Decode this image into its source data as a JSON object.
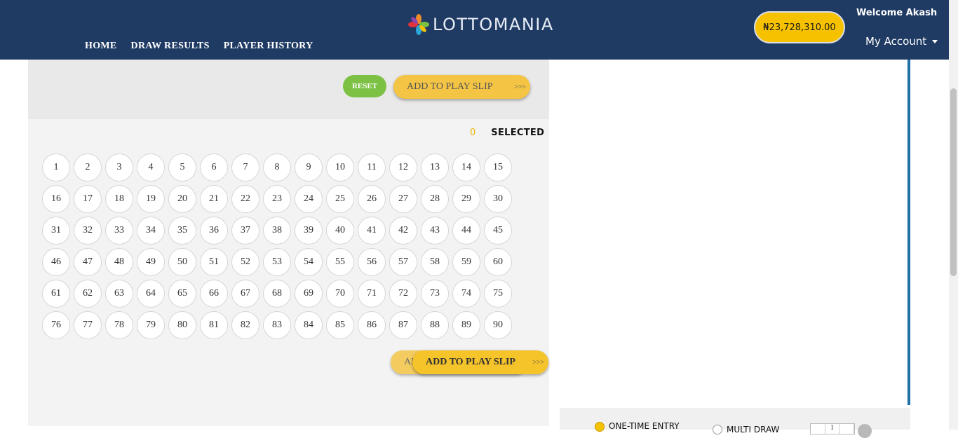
{
  "header": {
    "logo_text": "LOTTOMANIA",
    "nav": [
      "HOME",
      "DRAW RESULTS",
      "PLAYER HISTORY"
    ],
    "balance": "₦23,728,310.00",
    "welcome": "Welcome Akash",
    "account": "My Account"
  },
  "toolbar": {
    "reset_label": "RESET",
    "add_label": "ADD TO PLAY SLIP",
    "add_arrows": ">>>"
  },
  "selection": {
    "count": "0",
    "label": "SELECTED"
  },
  "numbers": [
    1,
    2,
    3,
    4,
    5,
    6,
    7,
    8,
    9,
    10,
    11,
    12,
    13,
    14,
    15,
    16,
    17,
    18,
    19,
    20,
    21,
    22,
    23,
    24,
    25,
    26,
    27,
    28,
    29,
    30,
    31,
    32,
    33,
    34,
    35,
    36,
    37,
    38,
    39,
    40,
    41,
    42,
    43,
    44,
    45,
    46,
    47,
    48,
    49,
    50,
    51,
    52,
    53,
    54,
    55,
    56,
    57,
    58,
    59,
    60,
    61,
    62,
    63,
    64,
    65,
    66,
    67,
    68,
    69,
    70,
    71,
    72,
    73,
    74,
    75,
    76,
    77,
    78,
    79,
    80,
    81,
    82,
    83,
    84,
    85,
    86,
    87,
    88,
    89,
    90
  ],
  "entry": {
    "one_time": "ONE-TIME ENTRY",
    "multi_draw": "MULTI DRAW",
    "draw_count": "1"
  },
  "colors": {
    "header_bg": "#1f3a63",
    "accent_yellow": "#f4c545",
    "reset_green": "#7cc144"
  }
}
